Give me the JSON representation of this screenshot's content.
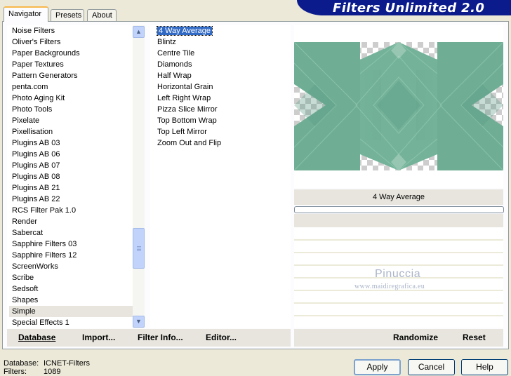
{
  "app": {
    "title": "Filters Unlimited 2.0"
  },
  "tabs": [
    "Navigator",
    "Presets",
    "About"
  ],
  "categories": [
    "Noise Filters",
    "Oliver's Filters",
    "Paper Backgrounds",
    "Paper Textures",
    "Pattern Generators",
    "penta.com",
    "Photo Aging Kit",
    "Photo Tools",
    "Pixelate",
    "Pixellisation",
    "Plugins AB 03",
    "Plugins AB 06",
    "Plugins AB 07",
    "Plugins AB 08",
    "Plugins AB 21",
    "Plugins AB 22",
    "RCS Filter Pak 1.0",
    "Render",
    "Sabercat",
    "Sapphire Filters 03",
    "Sapphire Filters 12",
    "ScreenWorks",
    "Scribe",
    "Sedsoft",
    "Shapes",
    "Simple",
    "Special Effects 1"
  ],
  "selected_category": "Simple",
  "filters": [
    "4 Way Average",
    "Blintz",
    "Centre Tile",
    "Diamonds",
    "Half Wrap",
    "Horizontal Grain",
    "Left Right Wrap",
    "Pizza Slice Mirror",
    "Top Bottom Wrap",
    "Top Left Mirror",
    "Zoom Out and Flip"
  ],
  "selected_filter": "4 Way Average",
  "preview": {
    "filter_name": "4 Way Average",
    "progress": 0
  },
  "watermark": {
    "name": "Pinuccia",
    "site": "www.maidiregrafica.eu"
  },
  "commands": {
    "database": "Database",
    "import": "Import...",
    "filter_info": "Filter Info...",
    "editor": "Editor...",
    "randomize": "Randomize",
    "reset": "Reset"
  },
  "status": {
    "database_label": "Database:",
    "database_value": "ICNET-Filters",
    "filters_label": "Filters:",
    "filters_value": "1089"
  },
  "buttons": {
    "apply": "Apply",
    "cancel": "Cancel",
    "help": "Help"
  },
  "colors": {
    "banner": "#0b1b8c",
    "selection": "#316ac5",
    "preview_teal": "#6fae95"
  }
}
